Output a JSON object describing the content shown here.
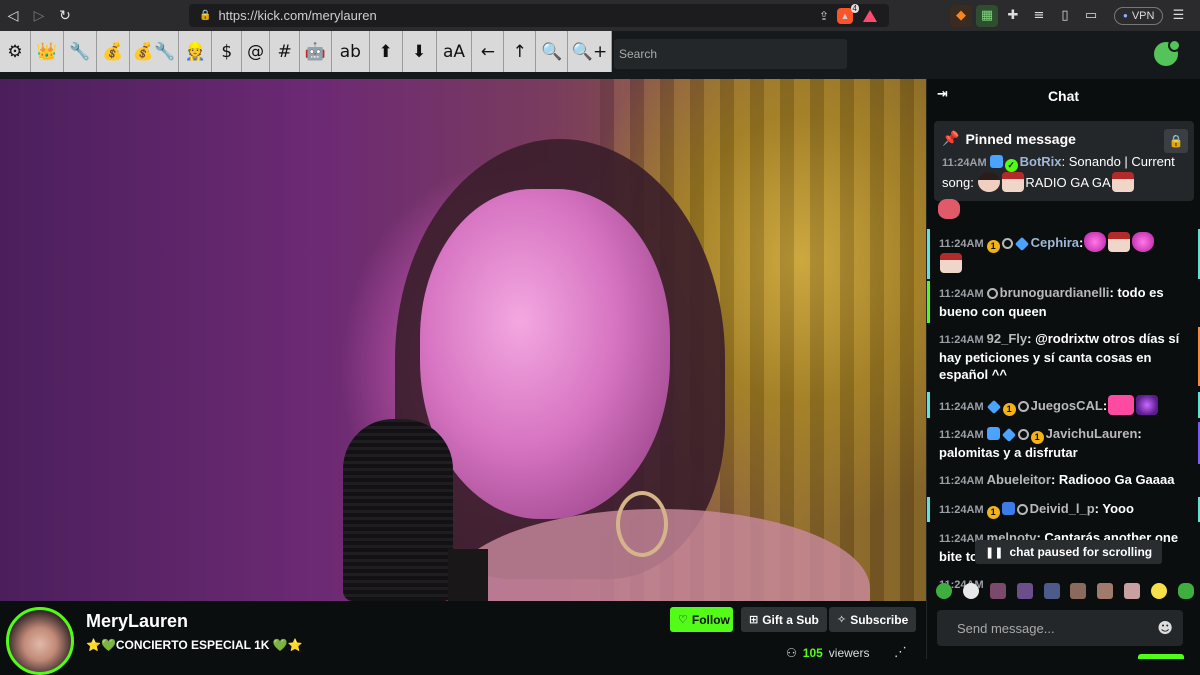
{
  "browser": {
    "url": "https://kick.com/merylauren",
    "nav": {
      "back": "◁",
      "forward": "▷",
      "reload": "↻"
    },
    "shield_count": "4",
    "vpn_label": "VPN"
  },
  "toolbar": {
    "buttons": [
      "⚙",
      "👑",
      "🔧",
      "💰",
      "💰🔧",
      "👷",
      "$",
      "@",
      "#",
      "🤖",
      "ab",
      "⬆",
      "⬇",
      "aA",
      "←",
      "↑",
      "🔍",
      "🔍+"
    ]
  },
  "search": {
    "placeholder": "Search"
  },
  "channel": {
    "name": "MeryLauren",
    "title": "⭐💚CONCIERTO ESPECIAL 1K 💚⭐",
    "follow_label": "Follow",
    "gift_label": "Gift a Sub",
    "subscribe_label": "Subscribe",
    "viewers_count": "105",
    "viewers_label": "viewers"
  },
  "chat": {
    "title": "Chat",
    "pinned_title": "Pinned message",
    "pinned": {
      "time": "11:24AM",
      "user": "BotRix",
      "text_a": ": Sonando | Current song: ",
      "text_b": "RADIO GA GA"
    },
    "messages": [
      {
        "time": "11:24AM",
        "user": "Cephira",
        "text": ":",
        "user_color": "#9fb7d6"
      },
      {
        "time": "11:24AM",
        "user": "brunoguardianelli",
        "text": ": todo es bueno con queen",
        "user_color": "#b9b9b9"
      },
      {
        "time": "11:24AM",
        "user": "92_Fly",
        "text": ": @rodrixtw otros días sí hay peticiones y sí canta cosas en español ^^",
        "user_color": "#b9b9b9"
      },
      {
        "time": "11:24AM",
        "user": "JuegosCAL",
        "text": ":",
        "user_color": "#b9b9b9"
      },
      {
        "time": "11:24AM",
        "user": "JavichuLauren",
        "text": ": palomitas y a disfrutar",
        "user_color": "#b9b9b9"
      },
      {
        "time": "11:24AM",
        "user": "Abueleitor",
        "text": ": Radiooo Ga Gaaaa",
        "user_color": "#b9b9b9"
      },
      {
        "time": "11:24AM",
        "user": "Deivid_l_p",
        "text": ": Yooo",
        "user_color": "#b9b9b9"
      },
      {
        "time": "11:24AM",
        "user": "melnotv",
        "text": ": Cantarás another one bite to dust",
        "user_color": "#b9b9b9"
      },
      {
        "time": "11:24AM",
        "user": "",
        "text": "",
        "user_color": "#b9b9b9"
      }
    ],
    "paused_label": "chat paused for scrolling",
    "send_placeholder": "Send message..."
  },
  "colors": {
    "accent": "#53fc18",
    "bg": "#0b0e0f",
    "panel": "#24272a"
  }
}
